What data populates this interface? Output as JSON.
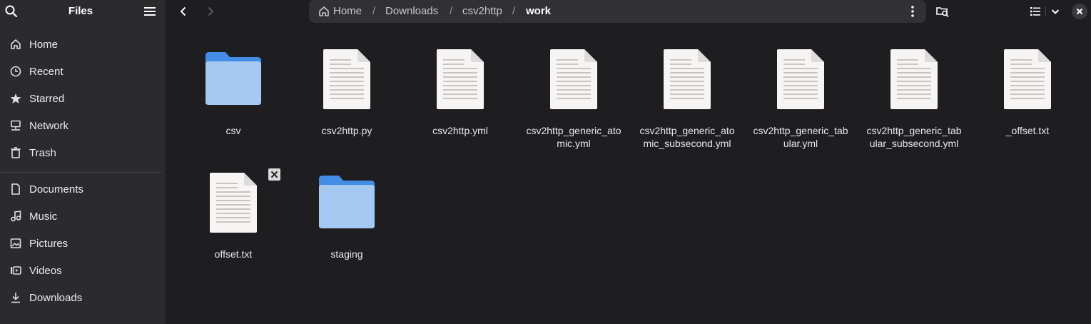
{
  "app": {
    "title": "Files"
  },
  "sidebar": {
    "items": [
      {
        "label": "Home",
        "icon": "home-icon"
      },
      {
        "label": "Recent",
        "icon": "clock-icon"
      },
      {
        "label": "Starred",
        "icon": "star-icon"
      },
      {
        "label": "Network",
        "icon": "network-icon"
      },
      {
        "label": "Trash",
        "icon": "trash-icon"
      },
      {
        "label": "Documents",
        "icon": "document-icon"
      },
      {
        "label": "Music",
        "icon": "music-icon"
      },
      {
        "label": "Pictures",
        "icon": "picture-icon"
      },
      {
        "label": "Videos",
        "icon": "video-icon"
      },
      {
        "label": "Downloads",
        "icon": "download-icon"
      }
    ]
  },
  "path": {
    "crumbs": [
      "Home",
      "Downloads",
      "csv2http",
      "work"
    ],
    "separator": "/"
  },
  "files": [
    {
      "name": "csv",
      "type": "folder"
    },
    {
      "name": "csv2http.py",
      "type": "text"
    },
    {
      "name": "csv2http.yml",
      "type": "text"
    },
    {
      "name": "csv2http_generic_atomic.yml",
      "type": "text"
    },
    {
      "name": "csv2http_generic_atomic_subsecond.yml",
      "type": "text"
    },
    {
      "name": "csv2http_generic_tabular.yml",
      "type": "text"
    },
    {
      "name": "csv2http_generic_tabular_subsecond.yml",
      "type": "text"
    },
    {
      "name": "_offset.txt",
      "type": "text"
    },
    {
      "name": "offset.txt",
      "type": "text",
      "has_remove_badge": true
    },
    {
      "name": "staging",
      "type": "folder"
    }
  ],
  "colors": {
    "sidebar_bg": "#2b2b2e",
    "content_bg": "#1e1e21",
    "folder_front": "#a4c8f0",
    "folder_back": "#438de6",
    "document": "#f6f5f4"
  }
}
